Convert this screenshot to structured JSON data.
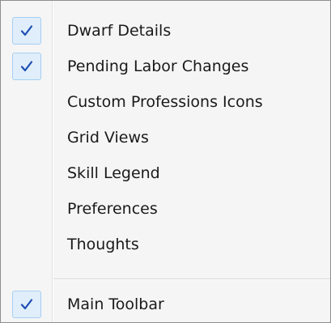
{
  "menu": {
    "items": [
      {
        "label": "Dwarf Details",
        "checked": true
      },
      {
        "label": "Pending Labor Changes",
        "checked": true
      },
      {
        "label": "Custom Professions  Icons",
        "checked": false
      },
      {
        "label": "Grid Views",
        "checked": false
      },
      {
        "label": "Skill Legend",
        "checked": false
      },
      {
        "label": "Preferences",
        "checked": false
      },
      {
        "label": "Thoughts",
        "checked": false
      }
    ],
    "bottom_items": [
      {
        "label": "Main Toolbar",
        "checked": true
      }
    ]
  },
  "icons": {
    "check": "checkmark-icon"
  },
  "colors": {
    "check": "#1f4fb4",
    "check_background": "#dfeefa",
    "check_border": "#a7cff2",
    "menu_background": "#f5f5f5"
  }
}
